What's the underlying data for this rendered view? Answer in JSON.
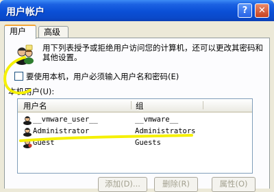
{
  "window": {
    "title": "用户帐户",
    "help_label": "?",
    "close_label": "✕"
  },
  "tabs": [
    {
      "label": "用户",
      "active": true
    },
    {
      "label": "高级",
      "active": false
    }
  ],
  "description": "用下列表授予或拒绝用户访问您的计算机，还可以更改其密码和其他设置。",
  "checkbox": {
    "label": "要使用本机，用户必须输入用户名和密码(E)",
    "checked": false
  },
  "section_label": "本机用户(U):",
  "table": {
    "columns": [
      "用户名",
      "组"
    ],
    "rows": [
      {
        "name": "__vmware_user__",
        "group": "__vmware__"
      },
      {
        "name": "Administrator",
        "group": "Administrators"
      },
      {
        "name": "Guest",
        "group": "Guests"
      }
    ]
  },
  "buttons": {
    "add": "添加(D)...",
    "remove": "删除(R)",
    "properties": "属性(O)"
  },
  "colors": {
    "titlebar": "#0a4fd6",
    "annotation": "#f5f000"
  },
  "icons": {
    "header_icon": "users-icon",
    "row_icon": "user-icon"
  }
}
